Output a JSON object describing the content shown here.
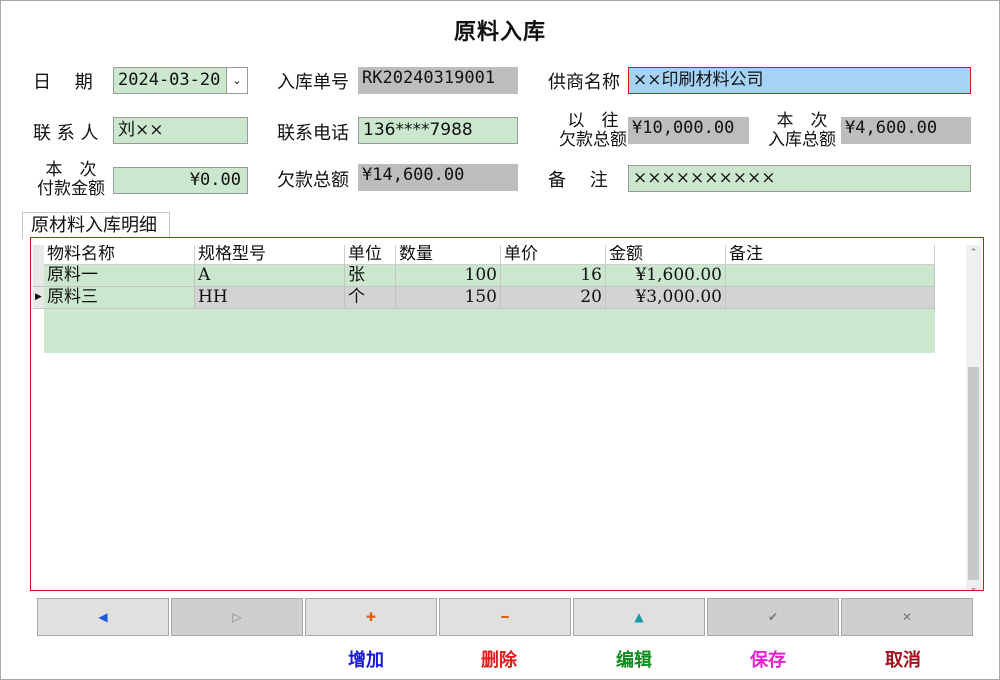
{
  "window": {
    "title": "原料入库"
  },
  "form": {
    "date_label": "日　 期",
    "date_value": "2024-03-20",
    "date_dropdown_glyph": "⌄",
    "receipt_no_label": "入库单号",
    "receipt_no_value": "RK20240319001",
    "supplier_label": "供商名称",
    "supplier_value": "××印刷材料公司",
    "contact_label": "联 系 人",
    "contact_value": "刘××",
    "phone_label": "联系电话",
    "phone_value": "136****7988",
    "prev_debt_label_line1": "以　往",
    "prev_debt_label_line2": "欠款总额",
    "prev_debt_value": "¥10,000.00",
    "this_receipt_label_line1": "本　次",
    "this_receipt_label_line2": "入库总额",
    "this_receipt_value": "¥4,600.00",
    "this_payment_label_line1": "本　次",
    "this_payment_label_line2": "付款金额",
    "this_payment_value": "¥0.00",
    "total_debt_label": "欠款总额",
    "total_debt_value": "¥14,600.00",
    "remark_label": "备　 注",
    "remark_value": "××××××××××"
  },
  "details": {
    "tab_label": "原材料入库明细",
    "columns": [
      "物料名称",
      "规格型号",
      "单位",
      "数量",
      "单价",
      "金额",
      "备注"
    ],
    "rows": [
      {
        "name": "原料一",
        "spec": "A",
        "unit": "张",
        "qty": "100",
        "price": "16",
        "amount": "¥1,600.00",
        "remark": "",
        "current": false
      },
      {
        "name": "原料三",
        "spec": "HH",
        "unit": "个",
        "qty": "150",
        "price": "20",
        "amount": "¥3,000.00",
        "remark": "",
        "current": true
      }
    ],
    "current_row_glyph": "▶"
  },
  "navigator": {
    "prev_glyph": "◀",
    "next_glyph": "▷",
    "add_glyph": "✚",
    "delete_glyph": "━",
    "edit_glyph": "▲",
    "save_glyph": "✔",
    "cancel_glyph": "✕"
  },
  "actions": {
    "add_label": "增加",
    "delete_label": "删除",
    "edit_label": "编辑",
    "save_label": "保存",
    "cancel_label": "取消"
  },
  "colors": {
    "field_green": "#cbe8cf",
    "field_grey": "#bdbdbd",
    "field_blue": "#a6d2f5",
    "focus_border": "#d01818",
    "add": "#1a1adb",
    "delete": "#e21b1b",
    "edit": "#138a1e",
    "save": "#e61fd0",
    "cancel": "#a0121b"
  },
  "scrollbar": {
    "up_glyph": "⌃",
    "down_glyph": "⌄"
  }
}
